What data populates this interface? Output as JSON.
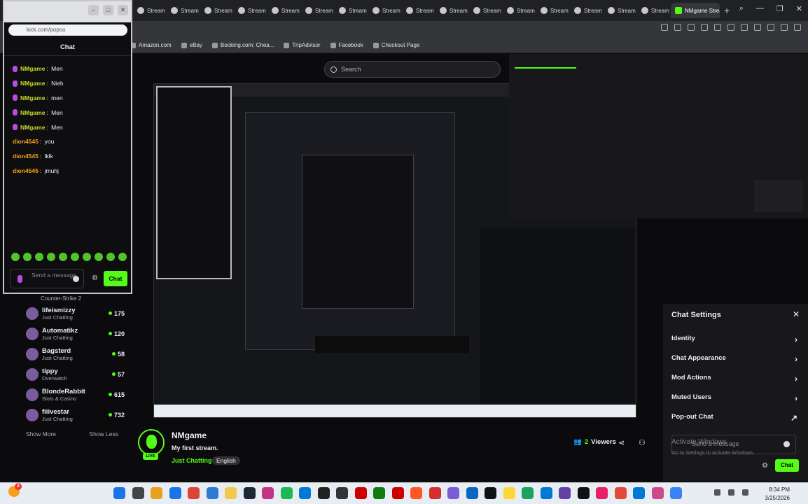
{
  "browser": {
    "tabs": [
      "Stream",
      "Stream",
      "Stream",
      "Stream",
      "Stream",
      "Stream",
      "Stream",
      "Stream",
      "Stream",
      "Stream",
      "Stream",
      "Stream",
      "Stream",
      "Stream",
      "Stream",
      "Stream"
    ],
    "active_tab": "NMgame Strea",
    "new_tab": "+",
    "bookmarks": [
      "Amazon.com",
      "eBay",
      "Booking.com: Chea...",
      "TripAdvisor",
      "Facebook",
      "Checkout Page"
    ]
  },
  "search": {
    "placeholder": "Search"
  },
  "popout": {
    "url": "kick.com/popou",
    "header": "Chat",
    "messages": [
      {
        "user": "NMgame",
        "text": "Men",
        "badge": true
      },
      {
        "user": "NMgame",
        "text": "Nieh",
        "badge": true
      },
      {
        "user": "NMgame",
        "text": "men",
        "badge": true
      },
      {
        "user": "NMgame",
        "text": "Men",
        "badge": true
      },
      {
        "user": "NMgame",
        "text": "Men",
        "badge": true
      },
      {
        "user": "dion4545",
        "text": "you",
        "badge": false
      },
      {
        "user": "dion4545",
        "text": "lklk",
        "badge": false
      },
      {
        "user": "dion4545",
        "text": "jmuhj",
        "badge": false
      }
    ],
    "input_placeholder": "Send a message",
    "chat_button": "Chat"
  },
  "sidebar": {
    "first_category": "Counter-Strike 2",
    "channels": [
      {
        "name": "lifeismizzy",
        "game": "Just Chatting",
        "viewers": "175"
      },
      {
        "name": "Automatikz",
        "game": "Just Chatting",
        "viewers": "120"
      },
      {
        "name": "Bagsterd",
        "game": "Just Chatting",
        "viewers": "58"
      },
      {
        "name": "tippy",
        "game": "Overwatch",
        "viewers": "57"
      },
      {
        "name": "BlondeRabbit",
        "game": "Slots & Casino",
        "viewers": "615"
      },
      {
        "name": "fiiivestar",
        "game": "Just Chatting",
        "viewers": "732"
      }
    ],
    "show_more": "Show More",
    "show_less": "Show Less"
  },
  "settings": {
    "title": "Chat Settings",
    "items": [
      "Identity",
      "Chat Appearance",
      "Mod Actions",
      "Muted Users",
      "Pop-out Chat"
    ],
    "input_placeholder": "Send a message",
    "watermark_title": "Activate Windows",
    "watermark_sub": "Go to Settings to activate Windows.",
    "chat_button": "Chat"
  },
  "stream": {
    "name": "NMgame",
    "title": "My first stream.",
    "category": "Just Chatting",
    "language": "English",
    "viewers": "2",
    "viewers_label": "Viewers",
    "live": "LIVE"
  },
  "taskbar": {
    "notification_count": "2",
    "time": "8:34 PM",
    "date": "3/25/2026"
  },
  "colors": {
    "accent": "#53fc18",
    "background": "#0b0b0d",
    "panel": "#18181b"
  }
}
